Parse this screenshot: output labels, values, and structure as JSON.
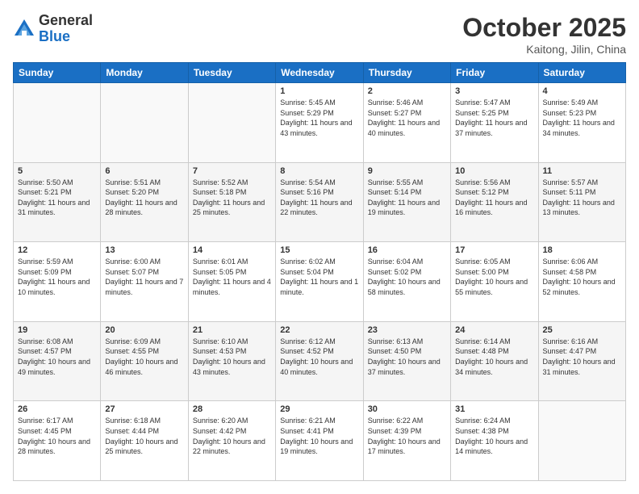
{
  "header": {
    "logo_general": "General",
    "logo_blue": "Blue",
    "month": "October 2025",
    "location": "Kaitong, Jilin, China"
  },
  "weekdays": [
    "Sunday",
    "Monday",
    "Tuesday",
    "Wednesday",
    "Thursday",
    "Friday",
    "Saturday"
  ],
  "weeks": [
    [
      {
        "day": "",
        "content": ""
      },
      {
        "day": "",
        "content": ""
      },
      {
        "day": "",
        "content": ""
      },
      {
        "day": "1",
        "content": "Sunrise: 5:45 AM\nSunset: 5:29 PM\nDaylight: 11 hours\nand 43 minutes."
      },
      {
        "day": "2",
        "content": "Sunrise: 5:46 AM\nSunset: 5:27 PM\nDaylight: 11 hours\nand 40 minutes."
      },
      {
        "day": "3",
        "content": "Sunrise: 5:47 AM\nSunset: 5:25 PM\nDaylight: 11 hours\nand 37 minutes."
      },
      {
        "day": "4",
        "content": "Sunrise: 5:49 AM\nSunset: 5:23 PM\nDaylight: 11 hours\nand 34 minutes."
      }
    ],
    [
      {
        "day": "5",
        "content": "Sunrise: 5:50 AM\nSunset: 5:21 PM\nDaylight: 11 hours\nand 31 minutes."
      },
      {
        "day": "6",
        "content": "Sunrise: 5:51 AM\nSunset: 5:20 PM\nDaylight: 11 hours\nand 28 minutes."
      },
      {
        "day": "7",
        "content": "Sunrise: 5:52 AM\nSunset: 5:18 PM\nDaylight: 11 hours\nand 25 minutes."
      },
      {
        "day": "8",
        "content": "Sunrise: 5:54 AM\nSunset: 5:16 PM\nDaylight: 11 hours\nand 22 minutes."
      },
      {
        "day": "9",
        "content": "Sunrise: 5:55 AM\nSunset: 5:14 PM\nDaylight: 11 hours\nand 19 minutes."
      },
      {
        "day": "10",
        "content": "Sunrise: 5:56 AM\nSunset: 5:12 PM\nDaylight: 11 hours\nand 16 minutes."
      },
      {
        "day": "11",
        "content": "Sunrise: 5:57 AM\nSunset: 5:11 PM\nDaylight: 11 hours\nand 13 minutes."
      }
    ],
    [
      {
        "day": "12",
        "content": "Sunrise: 5:59 AM\nSunset: 5:09 PM\nDaylight: 11 hours\nand 10 minutes."
      },
      {
        "day": "13",
        "content": "Sunrise: 6:00 AM\nSunset: 5:07 PM\nDaylight: 11 hours\nand 7 minutes."
      },
      {
        "day": "14",
        "content": "Sunrise: 6:01 AM\nSunset: 5:05 PM\nDaylight: 11 hours\nand 4 minutes."
      },
      {
        "day": "15",
        "content": "Sunrise: 6:02 AM\nSunset: 5:04 PM\nDaylight: 11 hours\nand 1 minute."
      },
      {
        "day": "16",
        "content": "Sunrise: 6:04 AM\nSunset: 5:02 PM\nDaylight: 10 hours\nand 58 minutes."
      },
      {
        "day": "17",
        "content": "Sunrise: 6:05 AM\nSunset: 5:00 PM\nDaylight: 10 hours\nand 55 minutes."
      },
      {
        "day": "18",
        "content": "Sunrise: 6:06 AM\nSunset: 4:58 PM\nDaylight: 10 hours\nand 52 minutes."
      }
    ],
    [
      {
        "day": "19",
        "content": "Sunrise: 6:08 AM\nSunset: 4:57 PM\nDaylight: 10 hours\nand 49 minutes."
      },
      {
        "day": "20",
        "content": "Sunrise: 6:09 AM\nSunset: 4:55 PM\nDaylight: 10 hours\nand 46 minutes."
      },
      {
        "day": "21",
        "content": "Sunrise: 6:10 AM\nSunset: 4:53 PM\nDaylight: 10 hours\nand 43 minutes."
      },
      {
        "day": "22",
        "content": "Sunrise: 6:12 AM\nSunset: 4:52 PM\nDaylight: 10 hours\nand 40 minutes."
      },
      {
        "day": "23",
        "content": "Sunrise: 6:13 AM\nSunset: 4:50 PM\nDaylight: 10 hours\nand 37 minutes."
      },
      {
        "day": "24",
        "content": "Sunrise: 6:14 AM\nSunset: 4:48 PM\nDaylight: 10 hours\nand 34 minutes."
      },
      {
        "day": "25",
        "content": "Sunrise: 6:16 AM\nSunset: 4:47 PM\nDaylight: 10 hours\nand 31 minutes."
      }
    ],
    [
      {
        "day": "26",
        "content": "Sunrise: 6:17 AM\nSunset: 4:45 PM\nDaylight: 10 hours\nand 28 minutes."
      },
      {
        "day": "27",
        "content": "Sunrise: 6:18 AM\nSunset: 4:44 PM\nDaylight: 10 hours\nand 25 minutes."
      },
      {
        "day": "28",
        "content": "Sunrise: 6:20 AM\nSunset: 4:42 PM\nDaylight: 10 hours\nand 22 minutes."
      },
      {
        "day": "29",
        "content": "Sunrise: 6:21 AM\nSunset: 4:41 PM\nDaylight: 10 hours\nand 19 minutes."
      },
      {
        "day": "30",
        "content": "Sunrise: 6:22 AM\nSunset: 4:39 PM\nDaylight: 10 hours\nand 17 minutes."
      },
      {
        "day": "31",
        "content": "Sunrise: 6:24 AM\nSunset: 4:38 PM\nDaylight: 10 hours\nand 14 minutes."
      },
      {
        "day": "",
        "content": ""
      }
    ]
  ]
}
